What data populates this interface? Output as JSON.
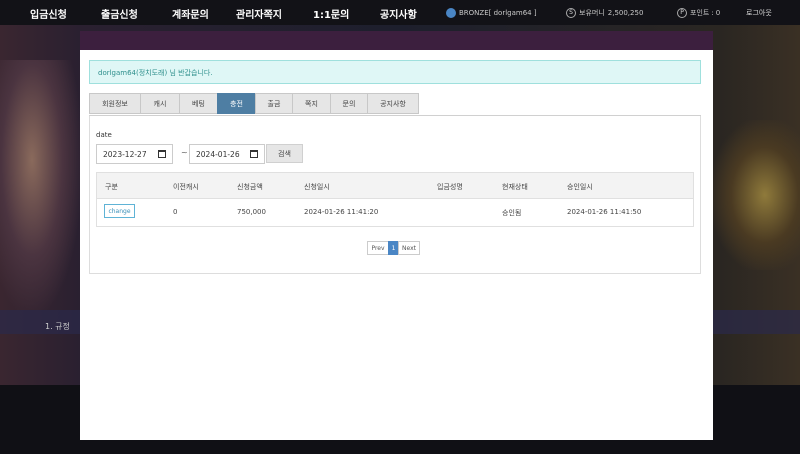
{
  "nav": {
    "items": [
      "입금신청",
      "출금신청",
      "계좌문의",
      "관리자쪽지",
      "1:1문의",
      "공지사항"
    ],
    "level": "BRONZE",
    "username_display": "[ dorlgam64 ]",
    "balance_label": "보유머니",
    "balance_value": "2,500,250",
    "point_label": "포인트",
    "point_value": "0",
    "logout": "로그아웃"
  },
  "background": {
    "notice_text": "1. 규정"
  },
  "modal": {
    "close_icon": "close-icon",
    "alert_text": "dorlgam64(정치도래) 님 반갑습니다.",
    "tabs": [
      "회원정보",
      "캐시",
      "베팅",
      "충전",
      "출금",
      "쪽지",
      "문의",
      "공지사항"
    ],
    "active_tab": "충전",
    "filter": {
      "label": "date",
      "start_date": "2023-12-27",
      "end_date": "2024-01-26",
      "separator": "~",
      "search_label": "검색"
    },
    "table": {
      "headers": [
        "구분",
        "이전캐시",
        "신청금액",
        "신청일시",
        "입금성명",
        "현재상태",
        "승인일시"
      ],
      "rows": [
        [
          "change",
          "0",
          "750,000",
          "2024-01-26 11:41:20",
          "",
          "승인됨",
          "2024-01-26 11:41:50"
        ]
      ]
    },
    "pagination": {
      "prev": "Prev",
      "current": "1",
      "next": "Next"
    }
  },
  "colors": {
    "modal_header": "#3c1f3e",
    "active_tab": "#4e7ea3",
    "alert_bg": "#dff7f6",
    "page_active": "#4a86c5"
  }
}
